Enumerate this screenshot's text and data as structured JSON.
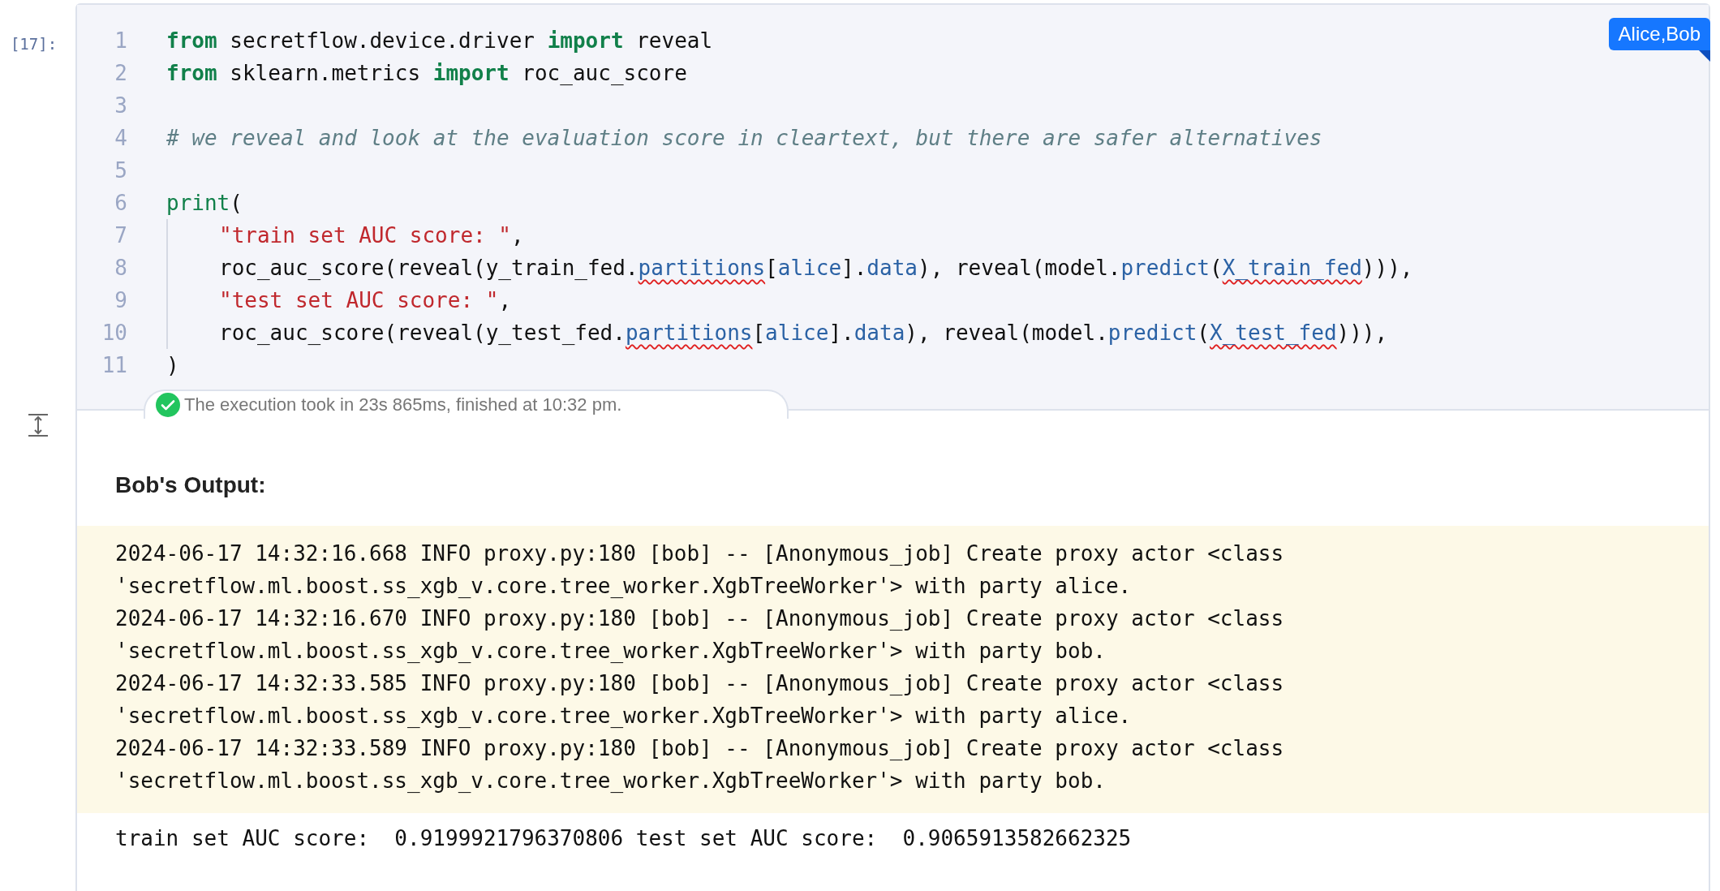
{
  "cell": {
    "prompt": "[17]:",
    "parties_badge": "Alice,Bob",
    "code_lines": [
      {
        "number": "1",
        "indent": false,
        "tokens": [
          {
            "text": "from",
            "kind": "keyword"
          },
          {
            "text": " secretflow.device.driver ",
            "kind": "plain"
          },
          {
            "text": "import",
            "kind": "keyword"
          },
          {
            "text": " reveal",
            "kind": "plain"
          }
        ]
      },
      {
        "number": "2",
        "indent": false,
        "tokens": [
          {
            "text": "from",
            "kind": "keyword"
          },
          {
            "text": " sklearn.metrics ",
            "kind": "plain"
          },
          {
            "text": "import",
            "kind": "keyword"
          },
          {
            "text": " roc_auc_score",
            "kind": "plain"
          }
        ]
      },
      {
        "number": "3",
        "indent": false
      },
      {
        "number": "4",
        "indent": false,
        "tokens": [
          {
            "text": "# we reveal and look at the evaluation score in cleartext, but there are safer alternatives",
            "kind": "comment"
          }
        ]
      },
      {
        "number": "5",
        "indent": false
      },
      {
        "number": "6",
        "indent": false,
        "tokens": [
          {
            "text": "print",
            "kind": "builtin"
          },
          {
            "text": "(",
            "kind": "plain"
          }
        ]
      },
      {
        "number": "7",
        "indent": true,
        "tokens": [
          {
            "text": "\"train set AUC score: \"",
            "kind": "string"
          },
          {
            "text": ",",
            "kind": "plain"
          }
        ]
      },
      {
        "number": "8",
        "indent": true,
        "tokens": [
          {
            "text": "roc_auc_score(reveal(y_train_fed.",
            "kind": "plain"
          },
          {
            "text": "partitions",
            "kind": "attribute",
            "squiggle": true
          },
          {
            "text": "[",
            "kind": "plain"
          },
          {
            "text": "alice",
            "kind": "attribute"
          },
          {
            "text": "].",
            "kind": "plain"
          },
          {
            "text": "data",
            "kind": "attribute"
          },
          {
            "text": "), reveal(model.",
            "kind": "plain"
          },
          {
            "text": "predict",
            "kind": "attribute"
          },
          {
            "text": "(",
            "kind": "plain"
          },
          {
            "text": "X_train_fed",
            "kind": "attribute",
            "squiggle": true
          },
          {
            "text": "))),",
            "kind": "plain"
          }
        ]
      },
      {
        "number": "9",
        "indent": true,
        "tokens": [
          {
            "text": "\"test set AUC score: \"",
            "kind": "string"
          },
          {
            "text": ",",
            "kind": "plain"
          }
        ]
      },
      {
        "number": "10",
        "indent": true,
        "tokens": [
          {
            "text": "roc_auc_score(reveal(y_test_fed.",
            "kind": "plain"
          },
          {
            "text": "partitions",
            "kind": "attribute",
            "squiggle": true
          },
          {
            "text": "[",
            "kind": "plain"
          },
          {
            "text": "alice",
            "kind": "attribute"
          },
          {
            "text": "].",
            "kind": "plain"
          },
          {
            "text": "data",
            "kind": "attribute"
          },
          {
            "text": "), reveal(model.",
            "kind": "plain"
          },
          {
            "text": "predict",
            "kind": "attribute"
          },
          {
            "text": "(",
            "kind": "plain"
          },
          {
            "text": "X_test_fed",
            "kind": "attribute",
            "squiggle": true
          },
          {
            "text": "))),",
            "kind": "plain"
          }
        ]
      },
      {
        "number": "11",
        "indent": false,
        "tokens": [
          {
            "text": ")",
            "kind": "plain"
          }
        ]
      }
    ],
    "execution": {
      "kind": "success",
      "message": "The execution took in 23s 865ms, finished at 10:32 pm."
    },
    "output": {
      "heading": "Bob's Output:",
      "log_lines": [
        "2024-06-17 14:32:16.668 INFO proxy.py:180 [bob] -- [Anonymous_job] Create proxy actor <class",
        "'secretflow.ml.boost.ss_xgb_v.core.tree_worker.XgbTreeWorker'> with party alice.",
        "2024-06-17 14:32:16.670 INFO proxy.py:180 [bob] -- [Anonymous_job] Create proxy actor <class",
        "'secretflow.ml.boost.ss_xgb_v.core.tree_worker.XgbTreeWorker'> with party bob.",
        "2024-06-17 14:32:33.585 INFO proxy.py:180 [bob] -- [Anonymous_job] Create proxy actor <class",
        "'secretflow.ml.boost.ss_xgb_v.core.tree_worker.XgbTreeWorker'> with party alice.",
        "2024-06-17 14:32:33.589 INFO proxy.py:180 [bob] -- [Anonymous_job] Create proxy actor <class",
        "'secretflow.ml.boost.ss_xgb_v.core.tree_worker.XgbTreeWorker'> with party bob."
      ],
      "result": "train set AUC score:  0.9199921796370806 test set AUC score:  0.9065913582662325"
    }
  }
}
